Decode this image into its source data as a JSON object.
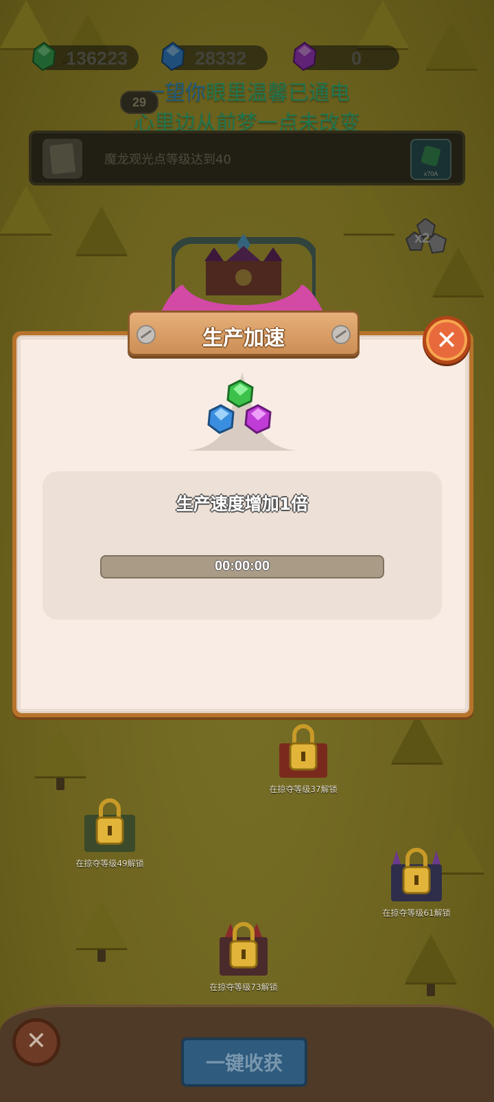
{
  "currency": {
    "green": {
      "value": "136223",
      "icon": "green-gem-icon",
      "color": "#3db35a"
    },
    "blue": {
      "value": "28332",
      "icon": "blue-gem-icon",
      "color": "#3a8ee0"
    },
    "purple": {
      "value": "0",
      "icon": "purple-gem-icon",
      "color": "#b03ed6"
    }
  },
  "lyrics": {
    "line1_hl": "一望你",
    "line1_rest": "眼里温馨已通电",
    "line2": "心里边从前梦一点未改变"
  },
  "level_badge": "29",
  "quest": {
    "text": "魔龙观光点等级达到40",
    "reward": "x70A"
  },
  "boost_badge": "x2",
  "dialog": {
    "title": "生产加速",
    "description": "生产速度增加1倍",
    "timer": "00:00:00",
    "progress": 0
  },
  "locked_buildings": [
    {
      "label": "在掠夺等级37解锁"
    },
    {
      "label": "在掠夺等级49解锁"
    },
    {
      "label": "在掠夺等级61解锁"
    },
    {
      "label": "在掠夺等级73解锁"
    }
  ],
  "bottom": {
    "harvest_label": "一键收获"
  }
}
